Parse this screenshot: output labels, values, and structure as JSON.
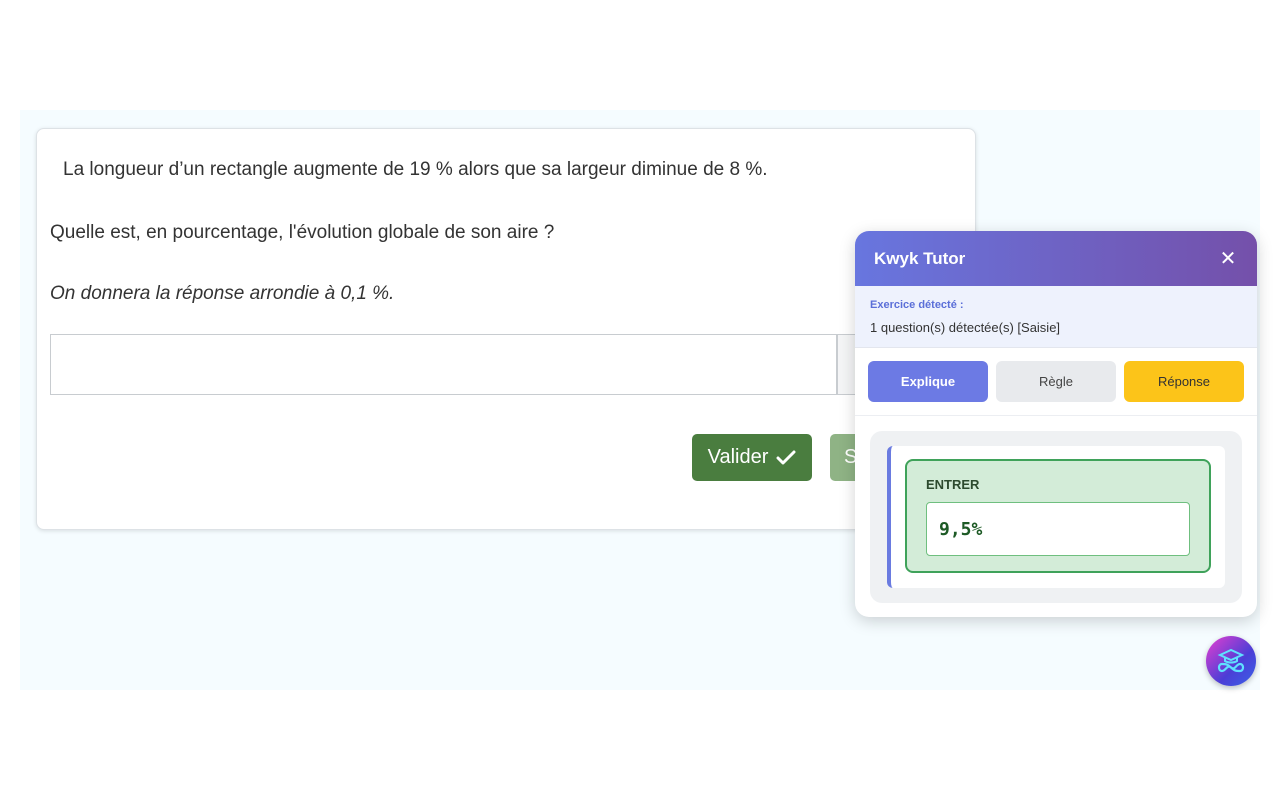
{
  "exercise": {
    "line1": "La longueur d’un rectangle augmente de 19 % alors que sa largeur diminue de 8 %.",
    "line2": "Quelle est, en pourcentage, l'évolution globale de son aire ?",
    "line3": "On donnera la réponse arrondie à 0,1 %.",
    "input_value": "",
    "validate_label": "Valider",
    "skip_label_visible": "S"
  },
  "tutor": {
    "title": "Kwyk Tutor",
    "close_icon": "close-icon",
    "detected_label": "Exercice détecté :",
    "detected_value": "1 question(s) détectée(s) [Saisie]",
    "tabs": [
      {
        "label": "Explique",
        "active": true,
        "color": "#6c7ae4"
      },
      {
        "label": "Règle",
        "active": false,
        "color": "#e8eaed"
      },
      {
        "label": "Réponse",
        "active": false,
        "color": "#fcc419"
      }
    ],
    "answer_label": "ENTRER",
    "answer_value": "9,5%"
  },
  "fab": {
    "icon": "graduation-cap-infinity-icon"
  },
  "colors": {
    "validate": "#4a7d3f",
    "header_start": "#6876df",
    "header_end": "#7450aa",
    "answer_border": "#3fa25a"
  }
}
